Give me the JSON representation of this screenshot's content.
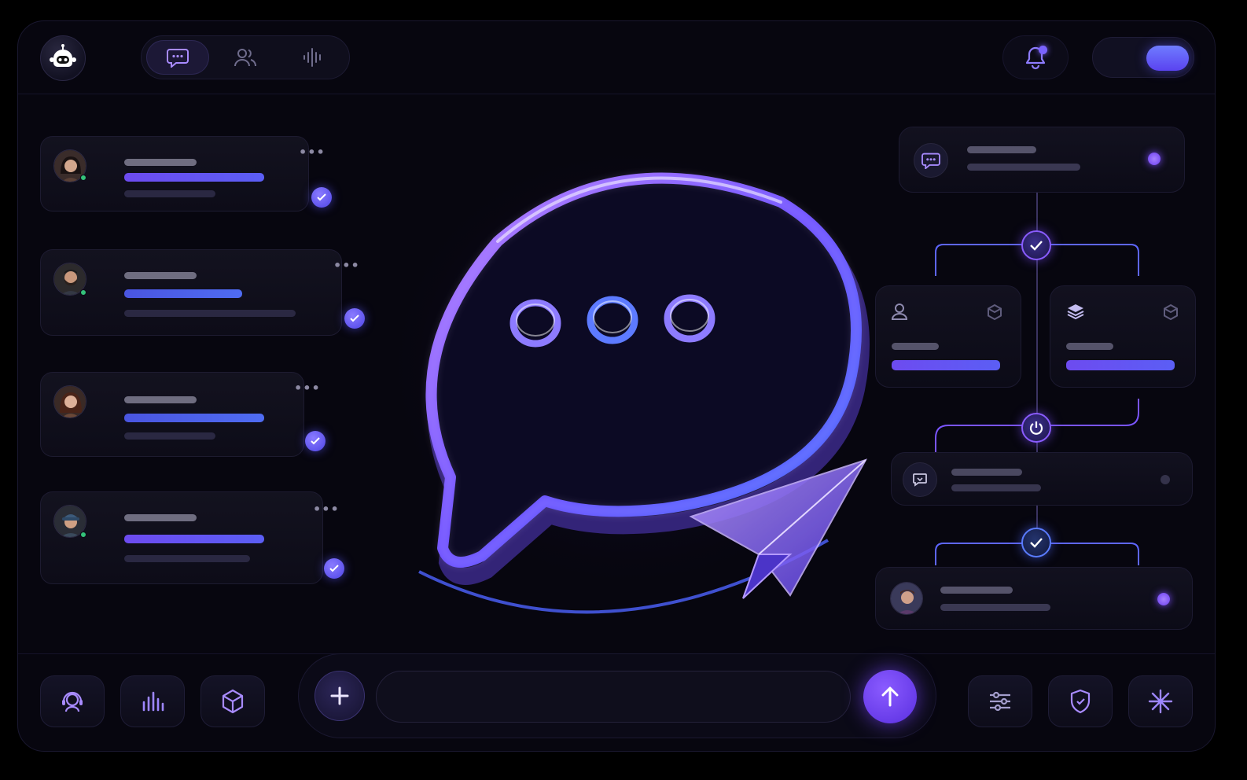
{
  "header": {
    "tabs": [
      {
        "icon": "chat-bubble-icon",
        "active": true
      },
      {
        "icon": "users-icon",
        "active": false
      },
      {
        "icon": "voice-waveform-icon",
        "active": false
      }
    ],
    "notifications": {
      "has_unread": true
    },
    "toggle": {
      "on": true
    }
  },
  "colors": {
    "accent": "#7a4dff",
    "accent_blue": "#5a6cff",
    "background": "#07060f",
    "card": "#12111f",
    "online": "#34c27a"
  },
  "conversations": [
    {
      "avatar": "woman-dark-hair",
      "online": true
    },
    {
      "avatar": "man-beard",
      "online": true
    },
    {
      "avatar": "woman-brown-hair",
      "online": false
    },
    {
      "avatar": "man-cap",
      "online": true
    }
  ],
  "workflow": {
    "nodes": [
      "check",
      "check",
      "power",
      "check"
    ],
    "cards": [
      "message",
      "user-task",
      "layers-task",
      "message-reply",
      "assignee"
    ]
  },
  "composer": {
    "placeholder": "",
    "value": ""
  },
  "bottom_left_tools": [
    "support-agent-icon",
    "analytics-icon",
    "cube-icon"
  ],
  "bottom_right_tools": [
    "sliders-icon",
    "shield-icon",
    "sparkle-icon"
  ]
}
